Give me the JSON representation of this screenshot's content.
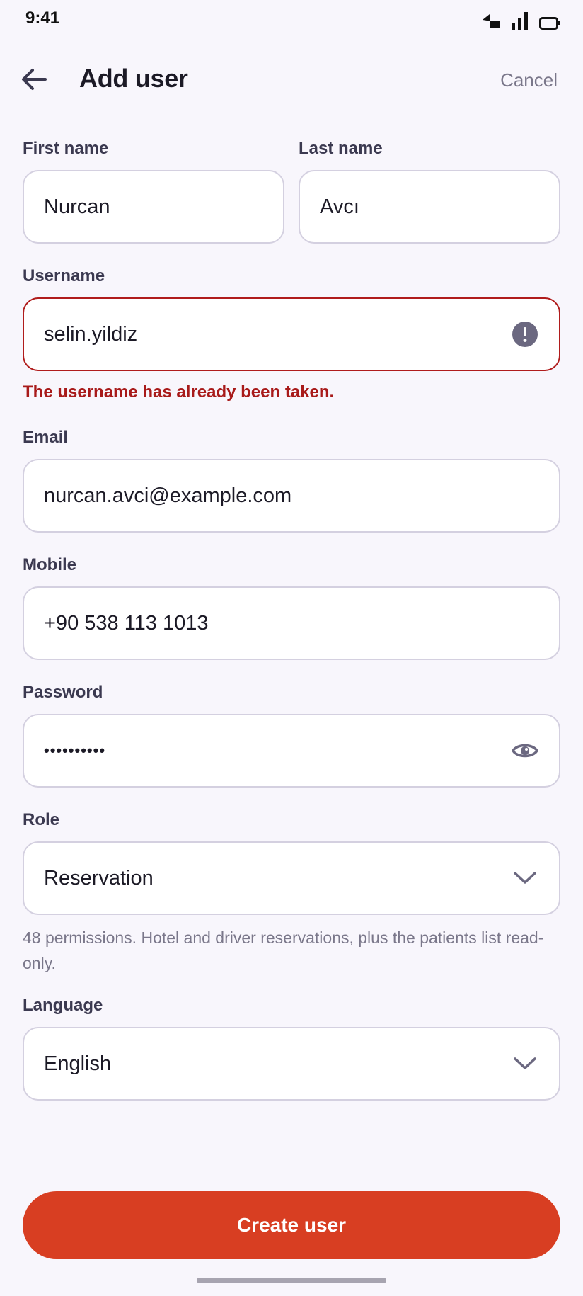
{
  "status_bar": {
    "time": "9:41"
  },
  "header": {
    "title": "Add user",
    "cancel_label": "Cancel"
  },
  "form": {
    "first_name": {
      "label": "First name",
      "value": "Nurcan"
    },
    "last_name": {
      "label": "Last name",
      "value": "Avcı"
    },
    "username": {
      "label": "Username",
      "value": "selin.yildiz",
      "error": "The username has already been taken."
    },
    "email": {
      "label": "Email",
      "value": "nurcan.avci@example.com"
    },
    "mobile": {
      "label": "Mobile",
      "value": "+90 538 113 1013"
    },
    "password": {
      "label": "Password",
      "value": "••••••••••"
    },
    "role": {
      "label": "Role",
      "value": "Reservation",
      "helper": "48 permissions. Hotel and driver reservations, plus the patients list read-only."
    },
    "language": {
      "label": "Language",
      "value": "English"
    }
  },
  "actions": {
    "submit_label": "Create user"
  },
  "colors": {
    "accent": "#d83e22",
    "error": "#a81a1a",
    "background": "#f8f6fc",
    "icon": "#6b6880"
  },
  "icons": [
    "back-arrow-icon",
    "alert-icon",
    "eye-icon",
    "chevron-down-icon"
  ]
}
